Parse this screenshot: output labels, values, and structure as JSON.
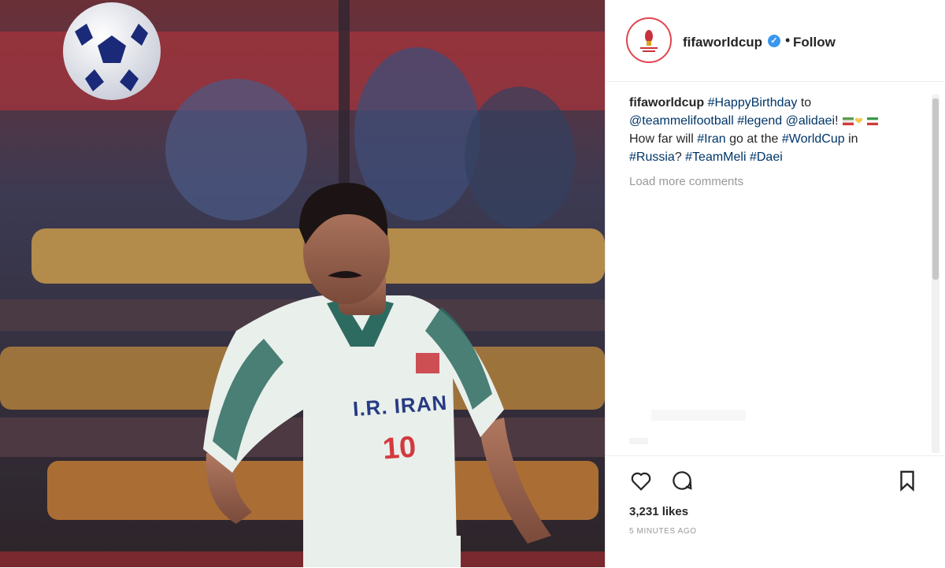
{
  "post": {
    "username": "fifaworldcup",
    "follow_label": "Follow",
    "separator": "•",
    "caption_parts": [
      {
        "text": "fifaworldcup",
        "type": "user"
      },
      {
        "text": " ",
        "type": "plain"
      },
      {
        "text": "#HappyBirthday",
        "type": "tag"
      },
      {
        "text": " to ",
        "type": "plain"
      },
      {
        "text": "@teammelifootball",
        "type": "tag"
      },
      {
        "text": " ",
        "type": "plain"
      },
      {
        "text": "#legend",
        "type": "tag"
      },
      {
        "text": " ",
        "type": "plain"
      },
      {
        "text": "@alidaei",
        "type": "tag"
      },
      {
        "text": "!",
        "type": "plain"
      },
      {
        "text": " How far will ",
        "type": "plain"
      },
      {
        "text": "#Iran",
        "type": "tag"
      },
      {
        "text": " go at the ",
        "type": "plain"
      },
      {
        "text": "#WorldCup",
        "type": "tag"
      },
      {
        "text": " in ",
        "type": "plain"
      },
      {
        "text": "#Russia",
        "type": "tag"
      },
      {
        "text": "? ",
        "type": "plain"
      },
      {
        "text": "#TeamMeli",
        "type": "tag"
      },
      {
        "text": " ",
        "type": "plain"
      },
      {
        "text": "#Daei",
        "type": "tag"
      }
    ],
    "load_more_label": "Load more comments",
    "likes_text": "3,231 likes",
    "time_ago": "5 MINUTES AGO",
    "icons": [
      "heart-icon",
      "comment-icon",
      "bookmark-icon"
    ]
  },
  "photo": {
    "jersey_team": "I.R. IRAN",
    "jersey_number": "10"
  },
  "colors": {
    "tag": "#003569",
    "text": "#262626",
    "muted": "#999999",
    "verified": "#3897f0",
    "avatar_ring": "#e0454f"
  }
}
